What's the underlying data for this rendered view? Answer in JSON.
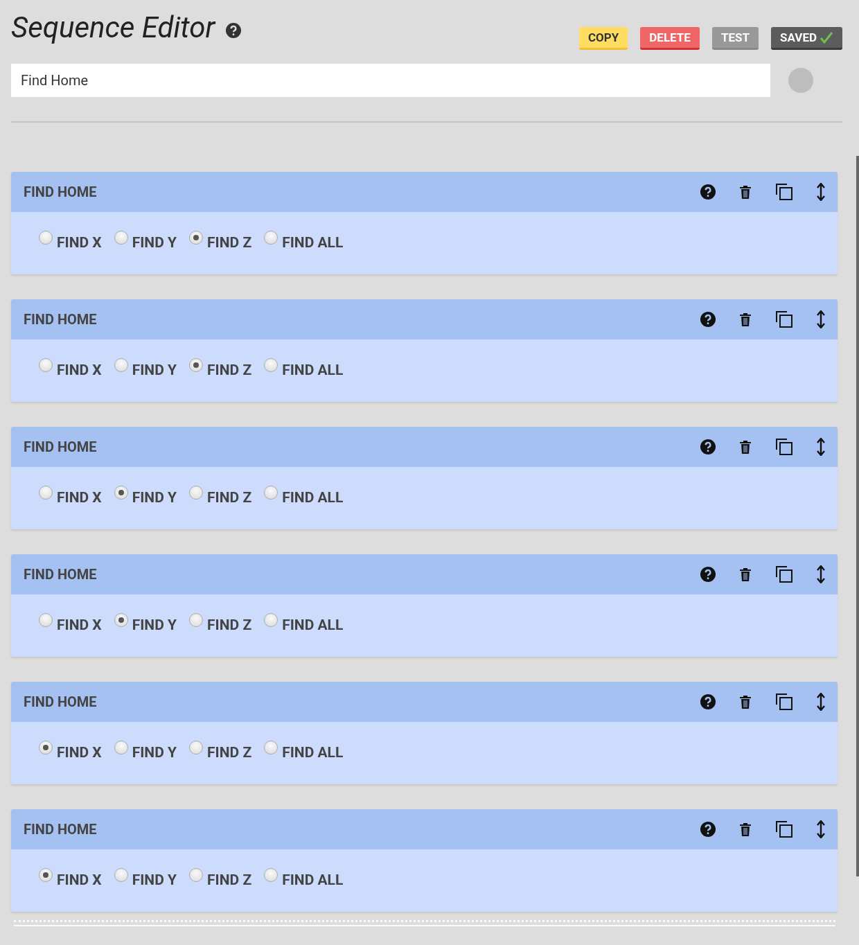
{
  "title": "Sequence Editor",
  "buttons": [
    {
      "label": "COPY",
      "kind": "copy"
    },
    {
      "label": "DELETE",
      "kind": "delete"
    },
    {
      "label": "TEST",
      "kind": "test"
    },
    {
      "label": "SAVED",
      "kind": "saved"
    }
  ],
  "name_field": {
    "value": "Find Home"
  },
  "steps": [
    {
      "title": "FIND HOME",
      "options": [
        {
          "label": "FIND X",
          "selected": false
        },
        {
          "label": "FIND Y",
          "selected": false
        },
        {
          "label": "FIND Z",
          "selected": true
        },
        {
          "label": "FIND ALL",
          "selected": false
        }
      ]
    },
    {
      "title": "FIND HOME",
      "options": [
        {
          "label": "FIND X",
          "selected": false
        },
        {
          "label": "FIND Y",
          "selected": false
        },
        {
          "label": "FIND Z",
          "selected": true
        },
        {
          "label": "FIND ALL",
          "selected": false
        }
      ]
    },
    {
      "title": "FIND HOME",
      "options": [
        {
          "label": "FIND X",
          "selected": false
        },
        {
          "label": "FIND Y",
          "selected": true
        },
        {
          "label": "FIND Z",
          "selected": false
        },
        {
          "label": "FIND ALL",
          "selected": false
        }
      ]
    },
    {
      "title": "FIND HOME",
      "options": [
        {
          "label": "FIND X",
          "selected": false
        },
        {
          "label": "FIND Y",
          "selected": true
        },
        {
          "label": "FIND Z",
          "selected": false
        },
        {
          "label": "FIND ALL",
          "selected": false
        }
      ]
    },
    {
      "title": "FIND HOME",
      "options": [
        {
          "label": "FIND X",
          "selected": true
        },
        {
          "label": "FIND Y",
          "selected": false
        },
        {
          "label": "FIND Z",
          "selected": false
        },
        {
          "label": "FIND ALL",
          "selected": false
        }
      ]
    },
    {
      "title": "FIND HOME",
      "options": [
        {
          "label": "FIND X",
          "selected": true
        },
        {
          "label": "FIND Y",
          "selected": false
        },
        {
          "label": "FIND Z",
          "selected": false
        },
        {
          "label": "FIND ALL",
          "selected": false
        }
      ]
    }
  ]
}
